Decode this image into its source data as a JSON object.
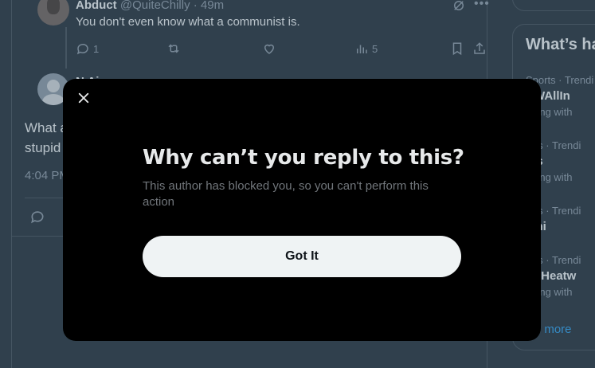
{
  "tweet1": {
    "author_name": "Abduct",
    "author_handle": "@QuiteChilly · 49m",
    "text": "You don't even know what a communist is.",
    "reply_count": "1",
    "views_count": "5"
  },
  "tweet2": {
    "author_name_partial": "N    Ai",
    "body_line1": "What a",
    "body_line2": "stupid",
    "time_partial": "4:04 PM"
  },
  "sidebar": {
    "trends_title": "What’s ha",
    "trends": [
      {
        "category": "Sports · Trendi",
        "name": "EWAllIn",
        "sub": "nding with"
      },
      {
        "category": "orts · Trendi",
        "name": "ms",
        "sub": "nding with"
      },
      {
        "category": "orts · Trendi",
        "name": "lani",
        "sub": ""
      },
      {
        "category": "orts · Trendi",
        "name": "XTHeatw",
        "sub": "nding with"
      }
    ],
    "show_more": "ow more"
  },
  "modal": {
    "title": "Why can’t you reply to this?",
    "description": "This author has blocked you, so you can't perform this action",
    "button_label": "Got It",
    "close_icon": "close-icon"
  },
  "colors": {
    "background": "#15202b",
    "modal_bg": "#000000",
    "button_bg": "#eff3f4",
    "accent": "#1d9bf0"
  }
}
